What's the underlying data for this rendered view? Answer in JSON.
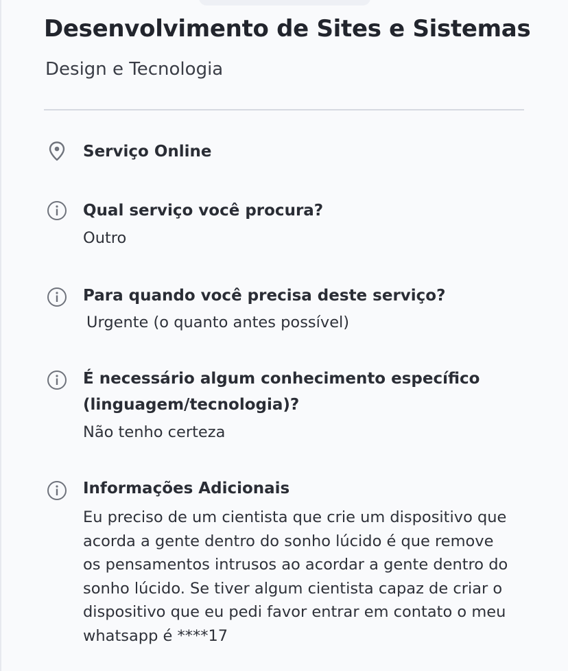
{
  "header": {
    "title": "Desenvolvimento de Sites e Sistemas",
    "subtitle": "Design e Tecnologia"
  },
  "location": {
    "icon": "map-pin-icon",
    "label": "Serviço Online"
  },
  "questions": [
    {
      "icon": "info-icon",
      "question": "Qual serviço você procura?",
      "answer": "Outro"
    },
    {
      "icon": "info-icon",
      "question": "Para quando você precisa deste serviço?",
      "answer": "Urgente (o quanto antes possível)"
    },
    {
      "icon": "info-icon",
      "question_lines": [
        "É necessário algum conhecimento específico",
        "(linguagem/tecnologia)?"
      ],
      "answer": "Não tenho certeza"
    },
    {
      "icon": "info-icon",
      "question": "Informações Adicionais",
      "answer_lines": [
        "Eu preciso de um cientista que crie um dispositivo que",
        "acorda a gente dentro do sonho lúcido é que remove",
        "os pensamentos intrusos ao acordar a gente dentro do",
        "sonho lúcido. Se tiver algum cientista capaz de criar o",
        "dispositivo que eu pedi favor entrar em contato o meu",
        "whatsapp é ****17"
      ]
    }
  ],
  "colors": {
    "background": "#f9fafc",
    "text": "#2b2e36",
    "icon": "#6f737c",
    "divider": "#d6d9e1"
  }
}
